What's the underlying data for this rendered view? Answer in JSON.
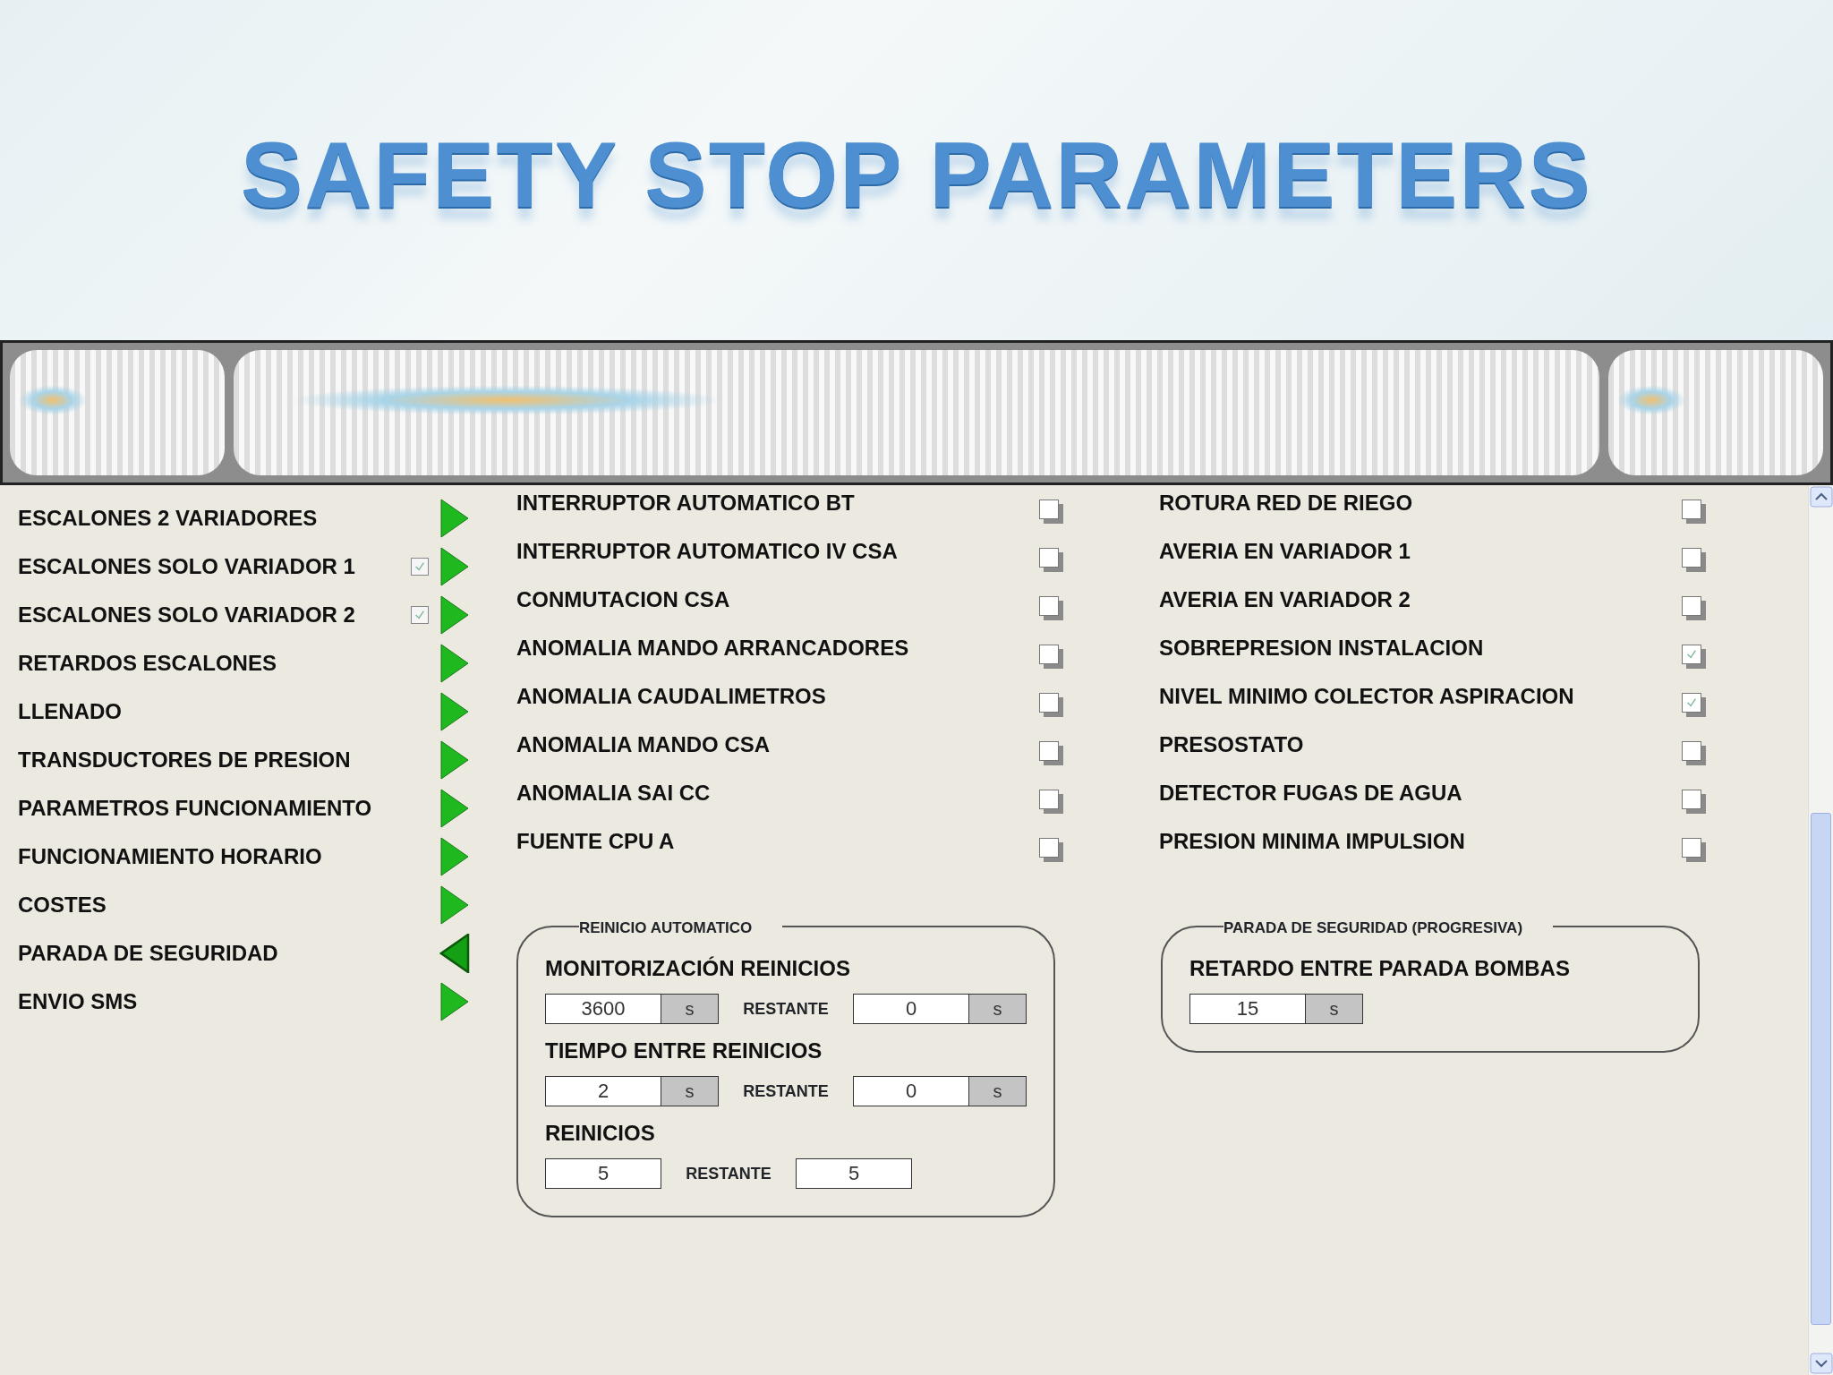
{
  "slide_title": "SAFETY STOP PARAMETERS",
  "menu": [
    {
      "label": "ESCALONES 2 VARIADORES",
      "kind": "plain",
      "selected": false
    },
    {
      "label": "ESCALONES SOLO VARIADOR 1",
      "kind": "checkbox",
      "checked": true,
      "selected": false
    },
    {
      "label": "ESCALONES SOLO VARIADOR 2",
      "kind": "checkbox",
      "checked": true,
      "selected": false
    },
    {
      "label": "RETARDOS ESCALONES",
      "kind": "plain",
      "selected": false
    },
    {
      "label": "LLENADO",
      "kind": "plain",
      "selected": false
    },
    {
      "label": "TRANSDUCTORES DE PRESION",
      "kind": "plain",
      "selected": false
    },
    {
      "label": "PARAMETROS FUNCIONAMIENTO",
      "kind": "plain",
      "selected": false
    },
    {
      "label": "FUNCIONAMIENTO HORARIO",
      "kind": "plain",
      "selected": false
    },
    {
      "label": "COSTES",
      "kind": "plain",
      "selected": false
    },
    {
      "label": "PARADA DE SEGURIDAD",
      "kind": "plain",
      "selected": true
    },
    {
      "label": "ENVIO SMS",
      "kind": "plain",
      "selected": false
    }
  ],
  "alarm_columns": [
    [
      {
        "label": "INTERRUPTOR AUTOMATICO BT",
        "checked": false
      },
      {
        "label": "INTERRUPTOR AUTOMATICO IV CSA",
        "checked": false
      },
      {
        "label": "CONMUTACION CSA",
        "checked": false
      },
      {
        "label": "ANOMALIA MANDO ARRANCADORES",
        "checked": false
      },
      {
        "label": "ANOMALIA CAUDALIMETROS",
        "checked": false
      },
      {
        "label": "ANOMALIA MANDO CSA",
        "checked": false
      },
      {
        "label": "ANOMALIA SAI CC",
        "checked": false
      },
      {
        "label": "FUENTE CPU A",
        "checked": false
      }
    ],
    [
      {
        "label": "ROTURA RED DE RIEGO",
        "checked": false
      },
      {
        "label": "AVERIA EN VARIADOR 1",
        "checked": false
      },
      {
        "label": "AVERIA EN VARIADOR 2",
        "checked": false
      },
      {
        "label": "SOBREPRESION INSTALACION",
        "checked": true
      },
      {
        "label": "NIVEL MINIMO COLECTOR ASPIRACION",
        "checked": true
      },
      {
        "label": "PRESOSTATO",
        "checked": false
      },
      {
        "label": "DETECTOR FUGAS DE AGUA",
        "checked": false
      },
      {
        "label": "PRESION MINIMA IMPULSION",
        "checked": false
      }
    ]
  ],
  "groups": [
    {
      "title": "REINICIO AUTOMATICO",
      "rows": [
        {
          "label": "MONITORIZACIÓN REINICIOS",
          "value": "3600",
          "unit": "s",
          "remaining_label": "RESTANTE",
          "remaining_value": "0",
          "remaining_unit": "s"
        },
        {
          "label": "TIEMPO ENTRE REINICIOS",
          "value": "2",
          "unit": "s",
          "remaining_label": "RESTANTE",
          "remaining_value": "0",
          "remaining_unit": "s"
        },
        {
          "label": "REINICIOS",
          "value": "5",
          "remaining_label": "RESTANTE",
          "remaining_value": "5"
        }
      ]
    },
    {
      "title": "PARADA DE SEGURIDAD (PROGRESIVA)",
      "rows": [
        {
          "label": "RETARDO ENTRE PARADA BOMBAS",
          "value": "15",
          "unit": "s"
        }
      ]
    }
  ]
}
